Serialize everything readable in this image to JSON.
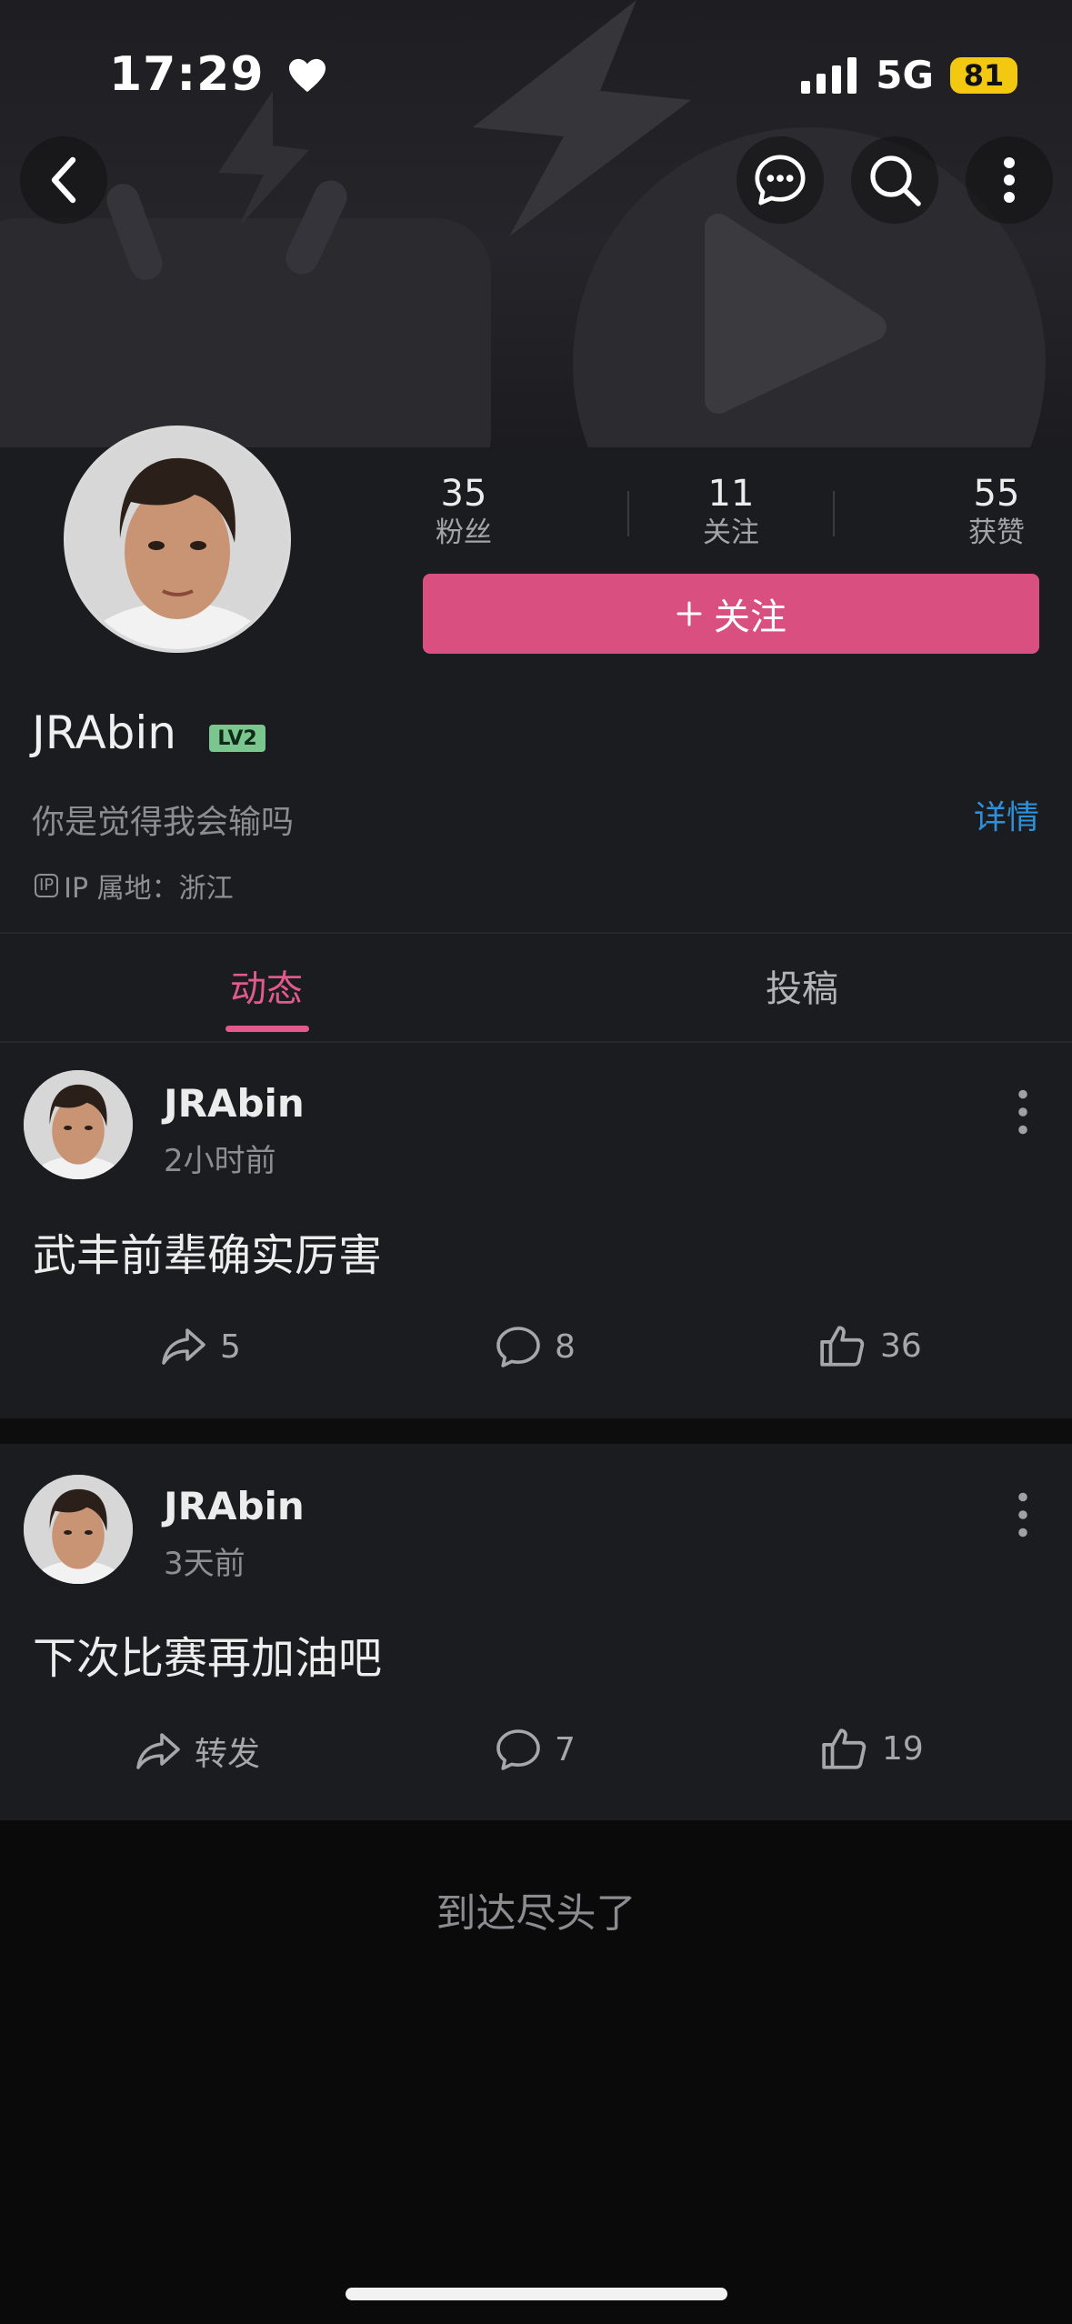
{
  "status_bar": {
    "time": "17:29",
    "network": "5G",
    "battery": "81"
  },
  "profile": {
    "stats": [
      {
        "value": "35",
        "label": "粉丝"
      },
      {
        "value": "11",
        "label": "关注"
      },
      {
        "value": "55",
        "label": "获赞"
      }
    ],
    "follow_label": "关注",
    "username": "JRAbin",
    "level_badge": "LV2",
    "bio": "你是觉得我会输吗",
    "detail_link": "详情",
    "ip_icon_text": "IP",
    "ip_location": "IP 属地：浙江"
  },
  "tabs": [
    {
      "label": "动态",
      "active": true
    },
    {
      "label": "投稿",
      "active": false
    }
  ],
  "posts": [
    {
      "author": "JRAbin",
      "time": "2小时前",
      "text": "武丰前辈确实厉害",
      "share": "5",
      "comments": "8",
      "likes": "36"
    },
    {
      "author": "JRAbin",
      "time": "3天前",
      "text": "下次比赛再加油吧",
      "share": "转发",
      "comments": "7",
      "likes": "19"
    }
  ],
  "end_text": "到达尽头了",
  "colors": {
    "accent": "#d94f7f",
    "tab_active": "#e05a8a",
    "link": "#2f8fd9",
    "battery": "#f2c811"
  }
}
